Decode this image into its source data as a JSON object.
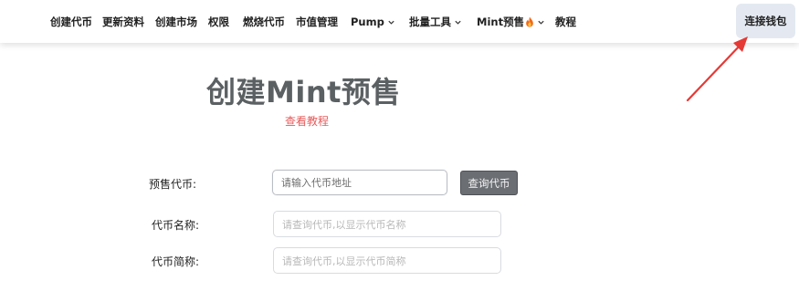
{
  "nav": {
    "items": [
      {
        "label": "创建代币"
      },
      {
        "label": "更新资料"
      },
      {
        "label": "创建市场"
      },
      {
        "label": "权限"
      },
      {
        "label": "燃烧代币"
      },
      {
        "label": "市值管理"
      },
      {
        "label": "Pump"
      },
      {
        "label": "批量工具"
      },
      {
        "label": "Mint预售"
      },
      {
        "label": "教程"
      }
    ],
    "connect_wallet": "连接钱包"
  },
  "main": {
    "title": "创建Mint预售",
    "tutorial_link": "查看教程"
  },
  "form": {
    "presale_token": {
      "label": "预售代币:",
      "placeholder": "请输入代币地址",
      "query_button": "查询代币"
    },
    "token_name": {
      "label": "代币名称:",
      "placeholder": "请查询代币,以显示代币名称"
    },
    "token_symbol": {
      "label": "代币简称:",
      "placeholder": "请查询代币,以显示代币简称"
    }
  },
  "colors": {
    "annotation_arrow": "#e53935",
    "title": "#5b6062",
    "link": "#e85a5a",
    "connect_bg": "#e4e9f1",
    "query_bg": "#6b6e73"
  },
  "icons": {
    "dropdown": "chevron-down-icon",
    "hot": "fire-icon"
  }
}
